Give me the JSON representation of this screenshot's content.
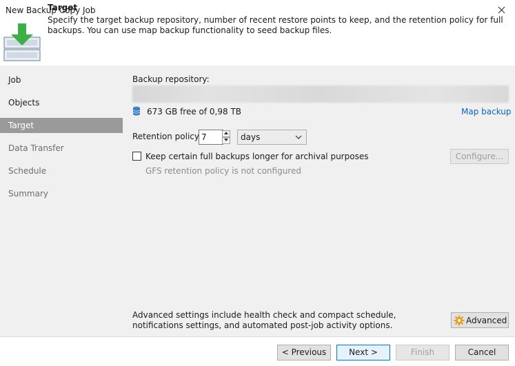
{
  "window": {
    "title": "New Backup Copy Job"
  },
  "header": {
    "title": "Target",
    "description": "Specify the target backup repository, number of recent restore points to keep, and the retention policy for full backups. You can use map backup functionality to seed backup files."
  },
  "sidebar": {
    "items": [
      {
        "label": "Job"
      },
      {
        "label": "Objects"
      },
      {
        "label": "Target"
      },
      {
        "label": "Data Transfer"
      },
      {
        "label": "Schedule"
      },
      {
        "label": "Summary"
      }
    ]
  },
  "repository": {
    "label": "Backup repository:",
    "free_space": "673 GB free of 0,98 TB",
    "map_backup": "Map backup"
  },
  "retention": {
    "label": "Retention policy:",
    "value": "7",
    "unit": "days"
  },
  "archival": {
    "checkbox_label": "Keep certain full backups longer for archival purposes",
    "checked": false,
    "configure_label": "Configure...",
    "status": "GFS retention policy is not configured"
  },
  "advanced": {
    "description": "Advanced settings include health check and compact schedule, notifications settings, and automated post-job activity options.",
    "button_label": "Advanced"
  },
  "footer": {
    "previous": "< Previous",
    "next": "Next >",
    "finish": "Finish",
    "cancel": "Cancel"
  },
  "colors": {
    "accent_green": "#3cb044",
    "link_blue": "#0a63c6",
    "active_nav": "#9a9a9a"
  }
}
